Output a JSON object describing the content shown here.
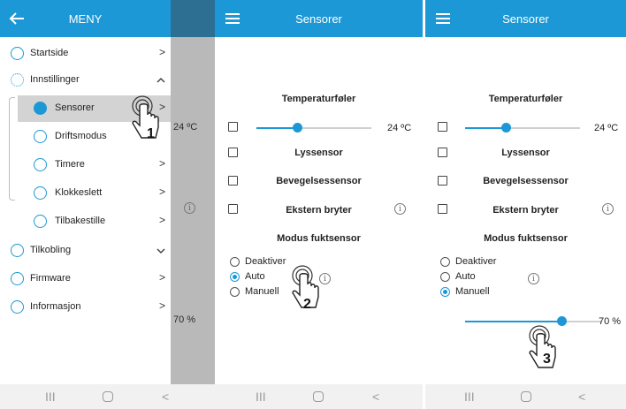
{
  "screen1": {
    "title": "MENY",
    "menu": [
      {
        "label": "Startside",
        "chev": ">"
      },
      {
        "label": "Innstillinger",
        "chev": "^"
      },
      {
        "label": "Sensorer",
        "chev": ">"
      },
      {
        "label": "Driftsmodus",
        "chev": ">"
      },
      {
        "label": "Timere",
        "chev": ">"
      },
      {
        "label": "Klokkeslett",
        "chev": ">"
      },
      {
        "label": "Tilbakestille",
        "chev": ">"
      },
      {
        "label": "Tilkobling",
        "chev": "v"
      },
      {
        "label": "Firmware",
        "chev": ">"
      },
      {
        "label": "Informasjon",
        "chev": ">"
      }
    ],
    "behind_temp": "24 ºC",
    "behind_info": "i",
    "behind_hum": "70 %",
    "step": "1"
  },
  "screen2": {
    "title": "Sensorer",
    "temp_title": "Temperaturføler",
    "temp_value": "24 ºC",
    "light": "Lyssensor",
    "motion": "Bevegelsessensor",
    "ext": "Ekstern bryter",
    "humidity_title": "Modus fuktsensor",
    "options": [
      "Deaktiver",
      "Auto",
      "Manuell"
    ],
    "selected": "Auto",
    "info": "i",
    "step": "2"
  },
  "screen3": {
    "title": "Sensorer",
    "temp_title": "Temperaturføler",
    "temp_value": "24 ºC",
    "light": "Lyssensor",
    "motion": "Bevegelsessensor",
    "ext": "Ekstern bryter",
    "humidity_title": "Modus fuktsensor",
    "options": [
      "Deaktiver",
      "Auto",
      "Manuell"
    ],
    "selected": "Manuell",
    "humidity_value": "70 %",
    "humidity_level_pct": 70,
    "info": "i",
    "step": "3"
  },
  "navbar": {
    "recent": "III",
    "back": "<"
  },
  "colors": {
    "accent": "#1c98d6",
    "active_bg": "#d3d3d3",
    "shade": "#b9b9b9"
  }
}
